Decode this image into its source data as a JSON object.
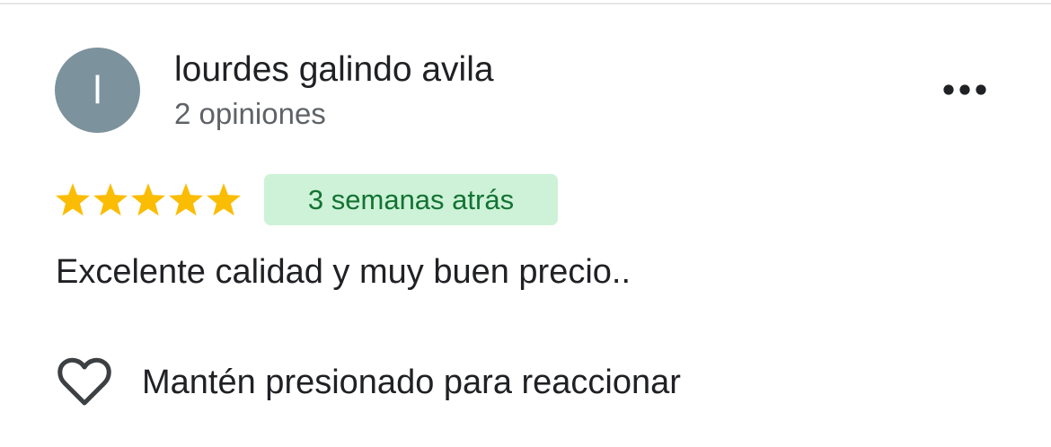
{
  "review": {
    "author": {
      "initial": "l",
      "name": "lourdes galindo avila",
      "review_count": "2 opiniones",
      "avatar_color": "#7c929d"
    },
    "rating": {
      "stars": 5,
      "max": 5,
      "star_color": "#fbbc04"
    },
    "date_badge": {
      "text": "3 semanas atrás",
      "background": "#cdf2d7",
      "text_color": "#137333"
    },
    "text": "Excelente calidad y muy buen precio..",
    "reaction": {
      "label": "Mantén presionado para reaccionar",
      "icon": "heart-outline-icon"
    },
    "menu_icon": "more-horizontal-icon"
  }
}
